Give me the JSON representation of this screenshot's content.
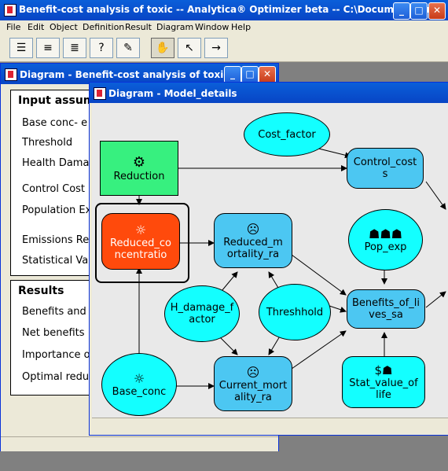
{
  "app": {
    "title": "Benefit-cost analysis of toxic -- Analytica® Optimizer beta -- C:\\Documents an...",
    "min": "_",
    "max": "□",
    "close": "✕"
  },
  "menu": [
    "File",
    "Edit",
    "Object",
    "Definition",
    "Result",
    "Diagram",
    "Window",
    "Help"
  ],
  "toolbar": {
    "icons": [
      "diagram-icon",
      "outline-icon",
      "list-icon",
      "help-icon",
      "expression-icon",
      "hand-icon",
      "arrow-icon",
      "connector-icon"
    ],
    "glyphs": [
      "☰",
      "≡",
      "≣",
      "?",
      "✎",
      "✋",
      "↖",
      "→"
    ]
  },
  "win1": {
    "title": "Diagram - Benefit-cost analysis of toxic e...",
    "inputs_title": "Input assum",
    "inputs": [
      "Base conc-  e",
      "Threshold",
      "Health Damag",
      "Control Cost F",
      "Population Ex",
      "Emissions Re",
      "Statistical Valu"
    ],
    "results_title": "Results",
    "results": [
      "Benefits and c",
      "Net benefits",
      "Importance of",
      "Optimal reduc"
    ]
  },
  "win2": {
    "title": "Diagram - Model_details",
    "nodes": {
      "cost_factor": "Cost_factor",
      "reduction": "Reduction",
      "control_costs": "Control_cost\ns",
      "reduced_conc": "Reduced_co\nncentratio",
      "reduced_mort": "Reduced_m\nortality_ra",
      "pop_exp": "Pop_exp",
      "h_damage": "H_damage_f\nactor",
      "threshhold": "Threshhold",
      "benefits": "Benefits_of_li\nves_sa",
      "base_conc": "Base_conc",
      "current_mort": "Current_mort\nality_ra",
      "stat_value": "Stat_value_of\nlife"
    }
  },
  "colors": {
    "decision": "#37f07f",
    "variable": "#4cc7f2",
    "constant": "#13ffff",
    "highlight": "#ff4a0c"
  }
}
